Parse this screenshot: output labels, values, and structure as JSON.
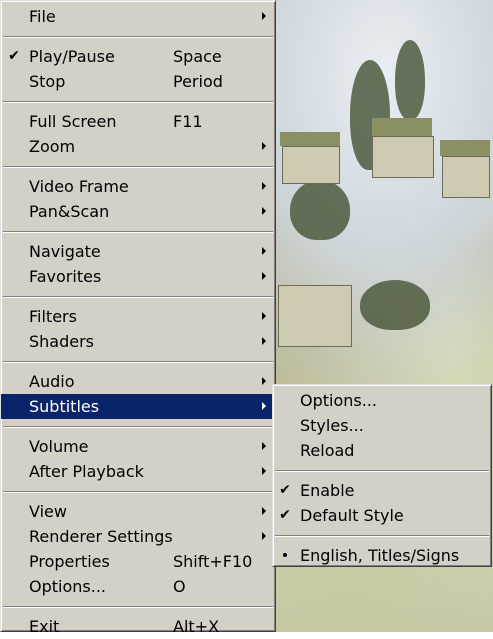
{
  "main_menu": {
    "groups": [
      [
        {
          "label": "File",
          "submenu": true
        }
      ],
      [
        {
          "label": "Play/Pause",
          "accel": "Space",
          "checked": true
        },
        {
          "label": "Stop",
          "accel": "Period"
        }
      ],
      [
        {
          "label": "Full Screen",
          "accel": "F11"
        },
        {
          "label": "Zoom",
          "submenu": true
        }
      ],
      [
        {
          "label": "Video Frame",
          "submenu": true
        },
        {
          "label": "Pan&Scan",
          "submenu": true
        }
      ],
      [
        {
          "label": "Navigate",
          "submenu": true
        },
        {
          "label": "Favorites",
          "submenu": true
        }
      ],
      [
        {
          "label": "Filters",
          "submenu": true
        },
        {
          "label": "Shaders",
          "submenu": true
        }
      ],
      [
        {
          "label": "Audio",
          "submenu": true
        },
        {
          "label": "Subtitles",
          "submenu": true,
          "highlighted": true
        }
      ],
      [
        {
          "label": "Volume",
          "submenu": true
        },
        {
          "label": "After Playback",
          "submenu": true
        }
      ],
      [
        {
          "label": "View",
          "submenu": true
        },
        {
          "label": "Renderer Settings",
          "submenu": true
        },
        {
          "label": "Properties",
          "accel": "Shift+F10"
        },
        {
          "label": "Options...",
          "accel": "O"
        }
      ],
      [
        {
          "label": "Exit",
          "accel": "Alt+X"
        }
      ]
    ]
  },
  "subtitles_menu": {
    "groups": [
      [
        {
          "label": "Options..."
        },
        {
          "label": "Styles..."
        },
        {
          "label": "Reload"
        }
      ],
      [
        {
          "label": "Enable",
          "checked": true
        },
        {
          "label": "Default Style",
          "checked": true
        }
      ],
      [
        {
          "label": "English, Titles/Signs",
          "radio": true
        }
      ]
    ]
  },
  "colors": {
    "menu_bg": "#d4d0c8",
    "highlight_bg": "#0a246a",
    "highlight_text": "#ffffff"
  },
  "icons": {
    "check": "check-icon",
    "submenu": "submenu-arrow-icon",
    "radio": "radio-dot-icon"
  }
}
